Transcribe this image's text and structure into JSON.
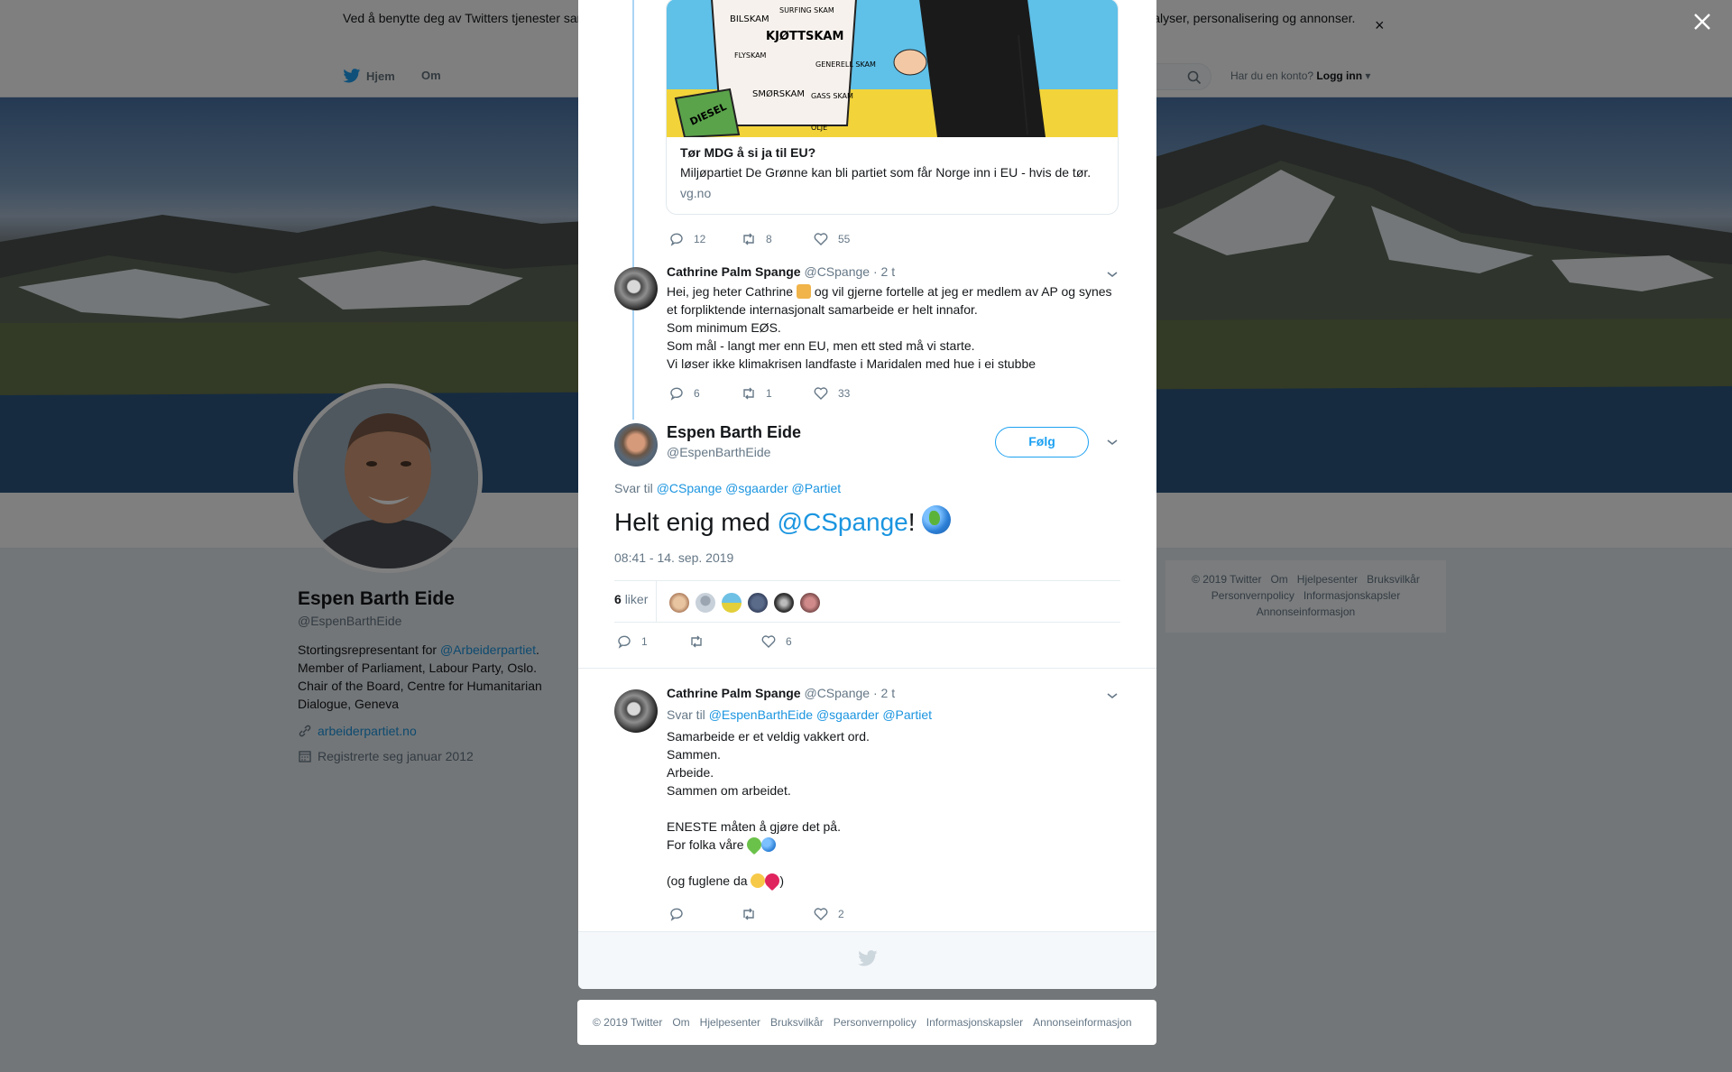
{
  "cookie_banner": {
    "text": "Ved å benytte deg av Twitters tjenester samtykker du i vår bruk av informasjonskapsler. Vi og våre partnere bruker informasjonskapsler til bl.a. analyser, personalisering og annonser.",
    "close": "×"
  },
  "nav": {
    "home": "Hjem",
    "about": "Om",
    "login_prompt": "Har du en konto?",
    "login": "Logg inn"
  },
  "profile": {
    "name": "Espen Barth Eide",
    "handle": "@EspenBarthEide",
    "bio_prefix": "Stortingsrepresentant for ",
    "bio_mention": "@Arbeiderpartiet",
    "bio_rest": ". Member of Parliament, Labour Party, Oslo. Chair of the Board, Centre for Humanitarian Dialogue, Geneva",
    "link": "arbeiderpartiet.no",
    "joined": "Registrerte seg januar 2012"
  },
  "right_footer": {
    "items": [
      "© 2019 Twitter",
      "Om",
      "Hjelpesenter",
      "Bruksvilkår",
      "Personvernpolicy",
      "Informasjonskapsler",
      "Annonseinformasjon"
    ]
  },
  "modal": {
    "card": {
      "title": "Tør MDG å si ja til EU?",
      "desc": "Miljøpartiet De Grønne kan bli partiet som får Norge inn i EU - hvis de tør.",
      "domain": "vg.no",
      "cartoon_words": [
        "BILSKAM",
        "SURFING SKAM",
        "KJØTTSKAM",
        "FLYSKAM",
        "GENERELL SKAM",
        "SMØRSKAM",
        "GASS SKAM",
        "OLJE",
        "DIESEL"
      ]
    },
    "tweet1_actions": {
      "replies": "12",
      "retweets": "8",
      "likes": "55"
    },
    "tweet2": {
      "name": "Cathrine Palm Spange",
      "handle": "@CSpange",
      "time": "· 2 t",
      "lines": [
        "Hei, jeg heter Cathrine",
        "og vil gjerne fortelle at jeg er medlem av AP og synes",
        "et forpliktende internasjonalt samarbeide er helt innafor.",
        "Som minimum EØS.",
        "Som mål - langt mer enn EU, men ett sted må vi starte.",
        "Vi løser ikke klimakrisen landfaste i Maridalen med hue i ei stubbe"
      ],
      "actions": {
        "replies": "6",
        "retweets": "1",
        "likes": "33"
      }
    },
    "main": {
      "name": "Espen Barth Eide",
      "handle": "@EspenBarthEide",
      "follow": "Følg",
      "reply_label": "Svar til",
      "reply_mentions": "@CSpange @sgaarder @Partiet",
      "text_prefix": "Helt enig med ",
      "text_mention": "@CSpange",
      "text_suffix": "!",
      "timestamp": "08:41 - 14. sep. 2019",
      "likes_count": "6",
      "likes_label": "liker",
      "actions": {
        "replies": "1",
        "retweets": "",
        "likes": "6"
      }
    },
    "tweet3": {
      "name": "Cathrine Palm Spange",
      "handle": "@CSpange",
      "time": "· 2 t",
      "reply_label": "Svar til",
      "reply_mentions": "@EspenBarthEide @sgaarder @Partiet",
      "lines": [
        "Samarbeide er et veldig vakkert ord.",
        "Sammen.",
        "Arbeide.",
        "Sammen om arbeidet.",
        "ENESTE måten å gjøre det på.",
        "For folka våre",
        "(og fuglene da",
        ")"
      ],
      "actions": {
        "replies": "",
        "retweets": "",
        "likes": "2"
      }
    }
  },
  "bottom_footer": {
    "items": [
      "© 2019 Twitter",
      "Om",
      "Hjelpesenter",
      "Bruksvilkår",
      "Personvernpolicy",
      "Informasjonskapsler",
      "Annonseinformasjon"
    ]
  },
  "colors": {
    "accent": "#1da1f2",
    "link": "#1b95e0",
    "thread": "#a9d5f5"
  }
}
